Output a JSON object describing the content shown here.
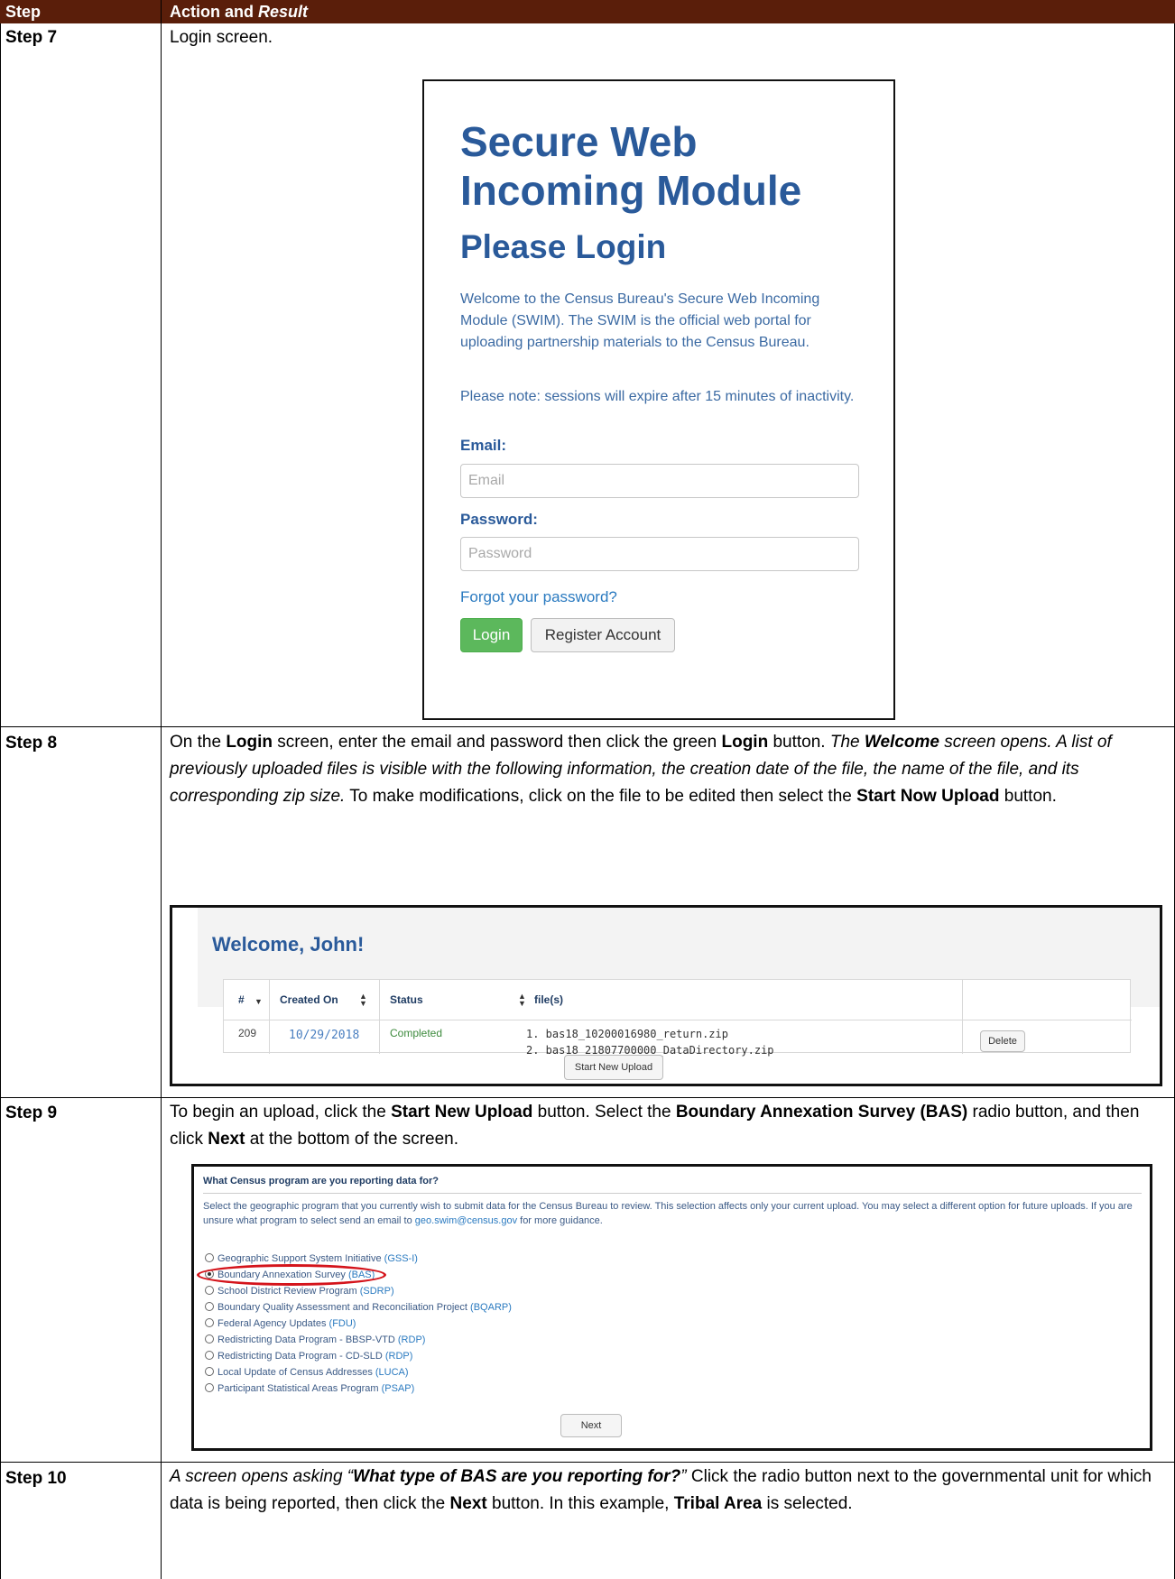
{
  "table": {
    "header": {
      "step": "Step",
      "action": "Action and ",
      "action_italic": "Result"
    }
  },
  "step7": {
    "label": "Step 7",
    "text": "Login screen.",
    "login": {
      "title": "Secure Web Incoming Module",
      "subtitle": "Please Login",
      "welcome_text": "Welcome to the Census Bureau's Secure Web Incoming Module (SWIM). The SWIM is the official web portal for uploading partnership materials to the Census Bureau.",
      "note_text": "Please note: sessions will expire after 15 minutes of inactivity.",
      "email_label": "Email:",
      "email_placeholder": "Email",
      "password_label": "Password:",
      "password_placeholder": "Password",
      "forgot_link": "Forgot your password?",
      "login_button": "Login",
      "register_button": "Register Account"
    }
  },
  "step8": {
    "label": "Step 8",
    "t1": "On the ",
    "b1": "Login",
    "t2": " screen, enter the email and password then click the green ",
    "b2": "Login",
    "t3": " button. ",
    "i1": "The ",
    "bi1": "Welcome",
    "i2": " screen opens. A list of previously uploaded files is visible with the following information, the creation date of the file, the name of the file, and its corresponding zip size.",
    "t4": " To make modifications, click on the file to be edited then select the ",
    "b3": "Start Now Upload",
    "t5": " button.",
    "welcome": {
      "title": "Welcome, John!",
      "columns": [
        "#",
        "Created On",
        "Status",
        "file(s)"
      ],
      "row": {
        "id": "209",
        "created_on": "10/29/2018",
        "status": "Completed",
        "files": [
          "1. bas18_10200016980_return.zip",
          "2. bas18_21807700000_DataDirectory.zip"
        ],
        "delete_button": "Delete"
      },
      "start_button": "Start New Upload",
      "colors": {
        "status": "#3c8a3c",
        "date": "#4a7fc0"
      }
    }
  },
  "step9": {
    "label": "Step 9",
    "t1": "To begin an upload, click the ",
    "b1": "Start New Upload",
    "t2": " button. Select the ",
    "b2": "Boundary Annexation Survey (BAS)",
    "t3": " radio button, and then click ",
    "b3": "Next",
    "t4": " at the bottom of the screen.",
    "program": {
      "title": "What Census program are you reporting data for?",
      "desc_before": "Select the geographic program that you currently wish to submit data for the Census Bureau to review. This selection affects only your current upload. You may select a different option for future uploads. If you are unsure what program to select send an email to ",
      "desc_email": "geo.swim@census.gov",
      "desc_after": " for more guidance.",
      "options": [
        {
          "label": "Geographic Support System Initiative ",
          "abbr": "(GSS-I)",
          "selected": false
        },
        {
          "label": "Boundary Annexation Survey ",
          "abbr": "(BAS)",
          "selected": true
        },
        {
          "label": "School District Review Program ",
          "abbr": "(SDRP)",
          "selected": false
        },
        {
          "label": "Boundary Quality Assessment and Reconciliation Project ",
          "abbr": "(BQARP)",
          "selected": false
        },
        {
          "label": "Federal Agency Updates ",
          "abbr": "(FDU)",
          "selected": false
        },
        {
          "label": "Redistricting Data Program - BBSP-VTD ",
          "abbr": "(RDP)",
          "selected": false
        },
        {
          "label": "Redistricting Data Program - CD-SLD ",
          "abbr": "(RDP)",
          "selected": false
        },
        {
          "label": "Local Update of Census Addresses ",
          "abbr": "(LUCA)",
          "selected": false
        },
        {
          "label": "Participant Statistical Areas Program ",
          "abbr": "(PSAP)",
          "selected": false
        }
      ],
      "next_button": "Next",
      "highlight_color": "#d4141b"
    }
  },
  "step10": {
    "label": "Step 10",
    "i1": "A screen opens asking “",
    "bi1": "What type of BAS are you reporting for?",
    "i2": "”",
    "t1": " Click the radio button next to the governmental unit for which data is being reported, then click the ",
    "b1": "Next",
    "t2": " button. In this example, ",
    "b2": "Tribal Area",
    "t3": " is selected."
  },
  "colors": {
    "header_bg": "#5a1e0a",
    "title_blue": "#2a5a9a",
    "link_blue": "#2a7ac0",
    "login_green": "#5cb85c"
  }
}
